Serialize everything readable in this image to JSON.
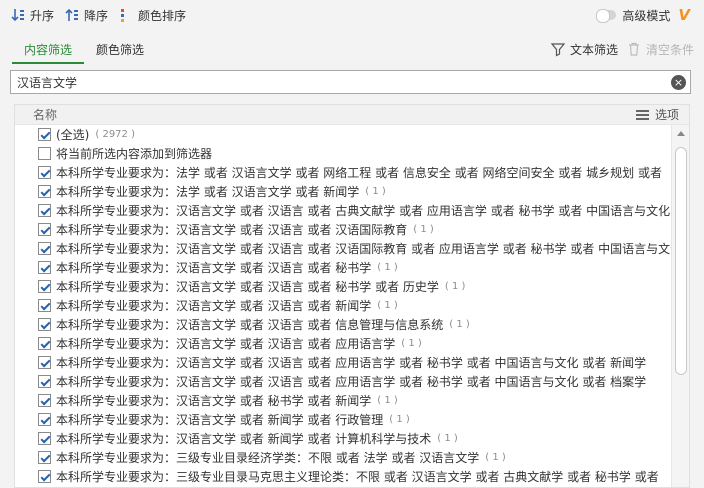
{
  "toolbar": {
    "asc_label": "升序",
    "desc_label": "降序",
    "color_sort_label": "颜色排序",
    "advanced_label": "高级模式",
    "brand_icon": "V"
  },
  "tabs": {
    "content_label": "内容筛选",
    "color_label": "颜色筛选",
    "text_filter_label": "文本筛选",
    "clear_label": "清空条件"
  },
  "search": {
    "value": "汉语言文学"
  },
  "list": {
    "header_label": "名称",
    "options_label": "选项",
    "select_all": {
      "label": "(全选)",
      "count": "( 2972 )",
      "checked": true
    },
    "add_to_filter": {
      "label": "将当前所选内容添加到筛选器",
      "checked": false
    },
    "rows": [
      {
        "text": "本科所学专业要求为：法学 或者 汉语言文学 或者 网络工程 或者 信息安全 或者 网络空间安全 或者 城乡规划 或者",
        "count": ""
      },
      {
        "text": "本科所学专业要求为：法学 或者 汉语言文学 或者 新闻学",
        "count": "( 1 )"
      },
      {
        "text": "本科所学专业要求为：汉语言文学 或者 汉语言 或者 古典文献学 或者 应用语言学 或者 秘书学 或者 中国语言与文化",
        "count": ""
      },
      {
        "text": "本科所学专业要求为：汉语言文学 或者 汉语言 或者 汉语国际教育",
        "count": "( 1 )"
      },
      {
        "text": "本科所学专业要求为：汉语言文学 或者 汉语言 或者 汉语国际教育 或者 应用语言学 或者 秘书学 或者 中国语言与文化",
        "count": ""
      },
      {
        "text": "本科所学专业要求为：汉语言文学 或者 汉语言 或者 秘书学",
        "count": "( 1 )"
      },
      {
        "text": "本科所学专业要求为：汉语言文学 或者 汉语言 或者 秘书学 或者 历史学",
        "count": "( 1 )"
      },
      {
        "text": "本科所学专业要求为：汉语言文学 或者 汉语言 或者 新闻学",
        "count": "( 1 )"
      },
      {
        "text": "本科所学专业要求为：汉语言文学 或者 汉语言 或者 信息管理与信息系统",
        "count": "( 1 )"
      },
      {
        "text": "本科所学专业要求为：汉语言文学 或者 汉语言 或者 应用语言学",
        "count": "( 1 )"
      },
      {
        "text": "本科所学专业要求为：汉语言文学 或者 汉语言 或者 应用语言学 或者 秘书学 或者 中国语言与文化 或者 新闻学",
        "count": ""
      },
      {
        "text": "本科所学专业要求为：汉语言文学 或者 汉语言 或者 应用语言学 或者 秘书学 或者 中国语言与文化 或者 档案学",
        "count": ""
      },
      {
        "text": "本科所学专业要求为：汉语言文学 或者 秘书学 或者 新闻学",
        "count": "( 1 )"
      },
      {
        "text": "本科所学专业要求为：汉语言文学 或者 新闻学 或者 行政管理",
        "count": "( 1 )"
      },
      {
        "text": "本科所学专业要求为：汉语言文学 或者 新闻学 或者 计算机科学与技术",
        "count": "( 1 )"
      },
      {
        "text": "本科所学专业要求为：三级专业目录经济学类：不限 或者 法学 或者 汉语言文学",
        "count": "( 1 )"
      },
      {
        "text": "本科所学专业要求为：三级专业目录马克思主义理论类：不限 或者 汉语言文学 或者 古典文献学 或者 秘书学 或者",
        "count": ""
      }
    ]
  },
  "colors": {
    "accent_green": "#2a8a38",
    "brand_orange": "#f39422",
    "check_blue": "#2563b0"
  }
}
